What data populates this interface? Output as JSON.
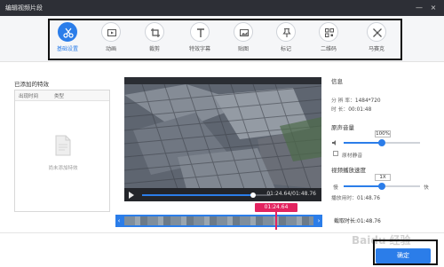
{
  "window": {
    "title": "编辑视频片段",
    "minimize": "—",
    "close": "×"
  },
  "toolbar": {
    "tools": [
      {
        "label": "基础设置",
        "icon": "scissors-icon",
        "active": true
      },
      {
        "label": "动画",
        "icon": "film-icon",
        "active": false
      },
      {
        "label": "裁剪",
        "icon": "crop-icon",
        "active": false
      },
      {
        "label": "特效字幕",
        "icon": "text-icon",
        "active": false
      },
      {
        "label": "贴图",
        "icon": "image-icon",
        "active": false
      },
      {
        "label": "标记",
        "icon": "pin-icon",
        "active": false
      },
      {
        "label": "二维码",
        "icon": "qrcode-icon",
        "active": false
      },
      {
        "label": "马赛克",
        "icon": "mosaic-icon",
        "active": false
      }
    ]
  },
  "effects_panel": {
    "title": "已添加的特效",
    "col_time": "出现时间",
    "col_type": "类型",
    "empty_text": "尚未添加特效"
  },
  "player": {
    "time_display": "01:24.64/01:48.76",
    "progress": 0.86,
    "cursor_time": "01:24.64"
  },
  "timeline": {
    "duration_label": "截取时长:01:48.76"
  },
  "info": {
    "title": "信息",
    "resolution_label": "分 辨 率：",
    "resolution": "1484*720",
    "duration_label": "时 长：",
    "duration": "00:01:48"
  },
  "volume": {
    "title": "原声音量",
    "value_label": "100%",
    "level": 0.5,
    "mute_label": "原材静音"
  },
  "speed": {
    "title": "视频播放速度",
    "value_label": "1X",
    "slow_label": "慢",
    "fast_label": "快",
    "level": 0.5,
    "play_time_label": "播放用时：",
    "play_time": "01:48.76"
  },
  "footer": {
    "confirm_label": "确定",
    "watermark": "Baidu 经验"
  },
  "colors": {
    "accent": "#2b7de9",
    "marker": "#e3235f",
    "titlebar": "#2d2f36"
  }
}
